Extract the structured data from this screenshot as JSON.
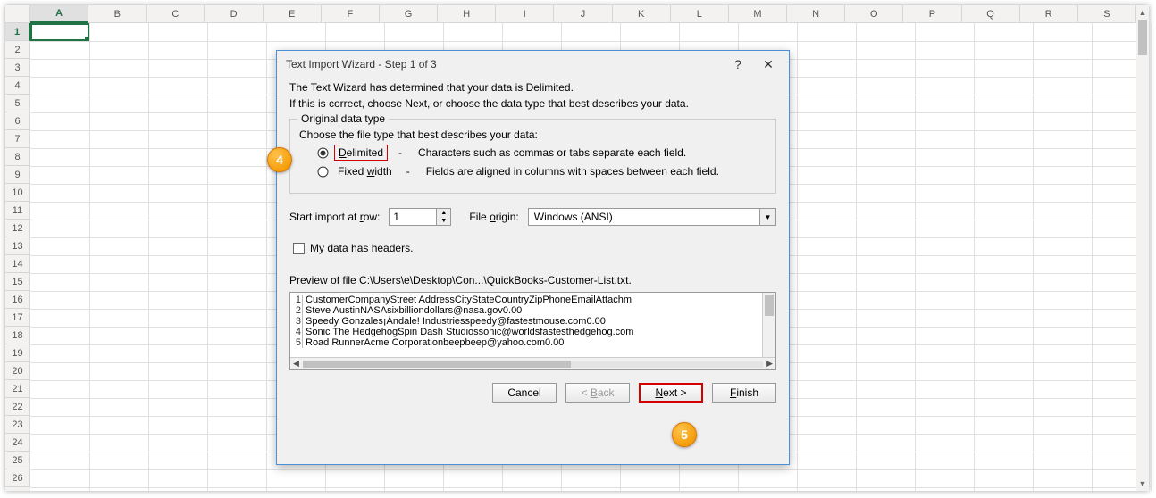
{
  "grid": {
    "columns": [
      "A",
      "B",
      "C",
      "D",
      "E",
      "F",
      "G",
      "H",
      "I",
      "J",
      "K",
      "L",
      "M",
      "N",
      "O",
      "P",
      "Q",
      "R",
      "S"
    ],
    "rows": 26,
    "selected_col": "A",
    "selected_row": 1
  },
  "dialog": {
    "title": "Text Import Wizard - Step 1 of 3",
    "help_icon": "?",
    "close_icon": "✕",
    "intro1": "The Text Wizard has determined that your data is Delimited.",
    "intro2": "If this is correct, choose Next, or choose the data type that best describes your data.",
    "group_label": "Original data type",
    "subheading": "Choose the file type that best describes your data:",
    "radio_delimited_label": "Delimited",
    "radio_delimited_desc": "Characters such as commas or tabs separate each field.",
    "radio_fixed_label": "Fixed width",
    "radio_fixed_desc": "Fields are aligned in columns with spaces between each field.",
    "start_row_label": "Start import at row:",
    "start_row_value": "1",
    "file_origin_label": "File origin:",
    "file_origin_value": "Windows (ANSI)",
    "headers_checkbox": "My data has headers.",
    "preview_label": "Preview of file C:\\Users\\e\\Desktop\\Con...\\QuickBooks-Customer-List.txt.",
    "preview_lines": [
      {
        "n": "1",
        "t": "CustomerCompanyStreet AddressCityStateCountryZipPhoneEmailAttachm"
      },
      {
        "n": "2",
        "t": "Steve AustinNASAsixbilliondollars@nasa.gov0.00"
      },
      {
        "n": "3",
        "t": "Speedy Gonzales¡Ándale! Industriesspeedy@fastestmouse.com0.00"
      },
      {
        "n": "4",
        "t": "Sonic The HedgehogSpin Dash Studiossonic@worldsfastesthedgehog.com"
      },
      {
        "n": "5",
        "t": "Road RunnerAcme Corporationbeepbeep@yahoo.com0.00"
      }
    ],
    "buttons": {
      "cancel": "Cancel",
      "back": "< Back",
      "next": "Next >",
      "finish": "Finish"
    }
  },
  "annotations": {
    "step4": "4",
    "step5": "5"
  }
}
